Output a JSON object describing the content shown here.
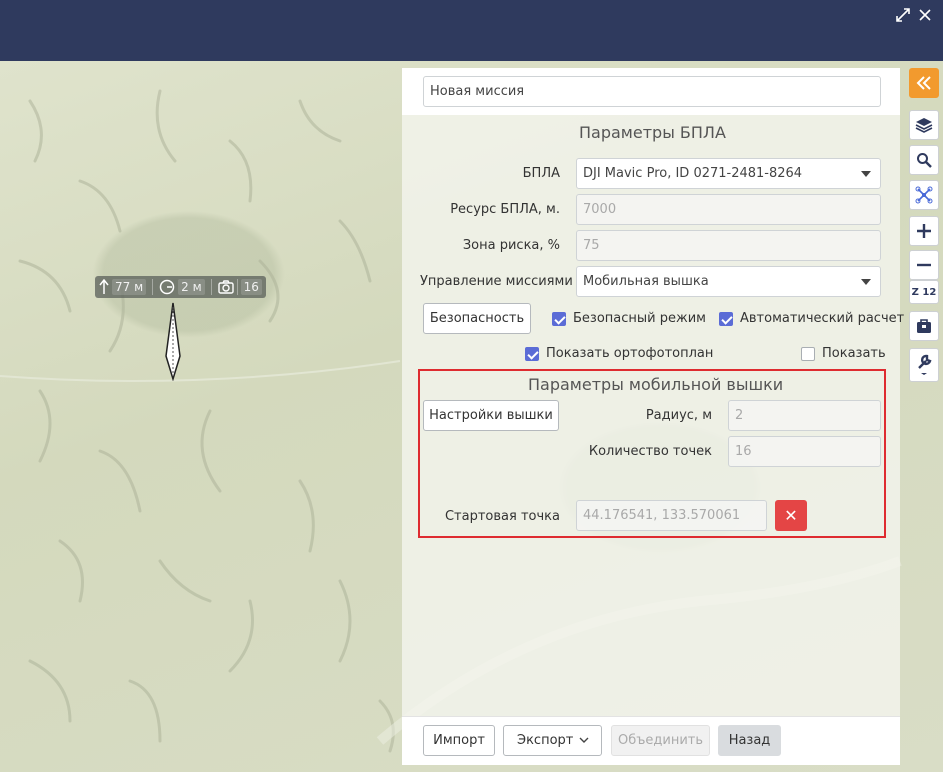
{
  "window": {
    "expand_icon": "expand-arrows-icon",
    "close_icon": "close-icon"
  },
  "drone_tag": {
    "altitude": "77 м",
    "speed": "2 м",
    "photos": "16"
  },
  "mission": {
    "name_value": "Новая миссия"
  },
  "uav_params": {
    "title": "Параметры БПЛА",
    "uav_label": "БПЛА",
    "uav_value": "DJI Mavic Pro, ID 0271-2481-8264",
    "resource_label": "Ресурс БПЛА, м.",
    "resource_value": "7000",
    "risk_label": "Зона риска, %",
    "risk_value": "75",
    "control_label": "Управление миссиями",
    "control_value": "Мобильная вышка",
    "safety_button": "Безопасность",
    "safe_mode_label": "Безопасный режим",
    "safe_mode_checked": true,
    "auto_calc_label": "Автоматический расчет",
    "auto_calc_checked": true,
    "ortho_label": "Показать ортофотоплан",
    "ortho_checked": true,
    "show_label": "Показать",
    "show_checked": false
  },
  "tower_params": {
    "title": "Параметры мобильной вышки",
    "settings_button": "Настройки вышки",
    "radius_label": "Радиус, м",
    "radius_value": "2",
    "points_label": "Количество точек",
    "points_value": "16",
    "start_label": "Стартовая точка",
    "start_value": "44.176541, 133.570061",
    "delete_symbol": "✕"
  },
  "footer": {
    "import": "Импорт",
    "export": "Экспорт",
    "merge": "Объединить",
    "back": "Назад"
  },
  "toolbar": {
    "zoom_label": "Z 12",
    "accent": "#f29a2e"
  },
  "colors": {
    "header_bg": "#2f3a5e",
    "checkbox_on": "#5b6cd6",
    "delete_bg": "#e44545",
    "highlight_frame": "#de2b30"
  }
}
